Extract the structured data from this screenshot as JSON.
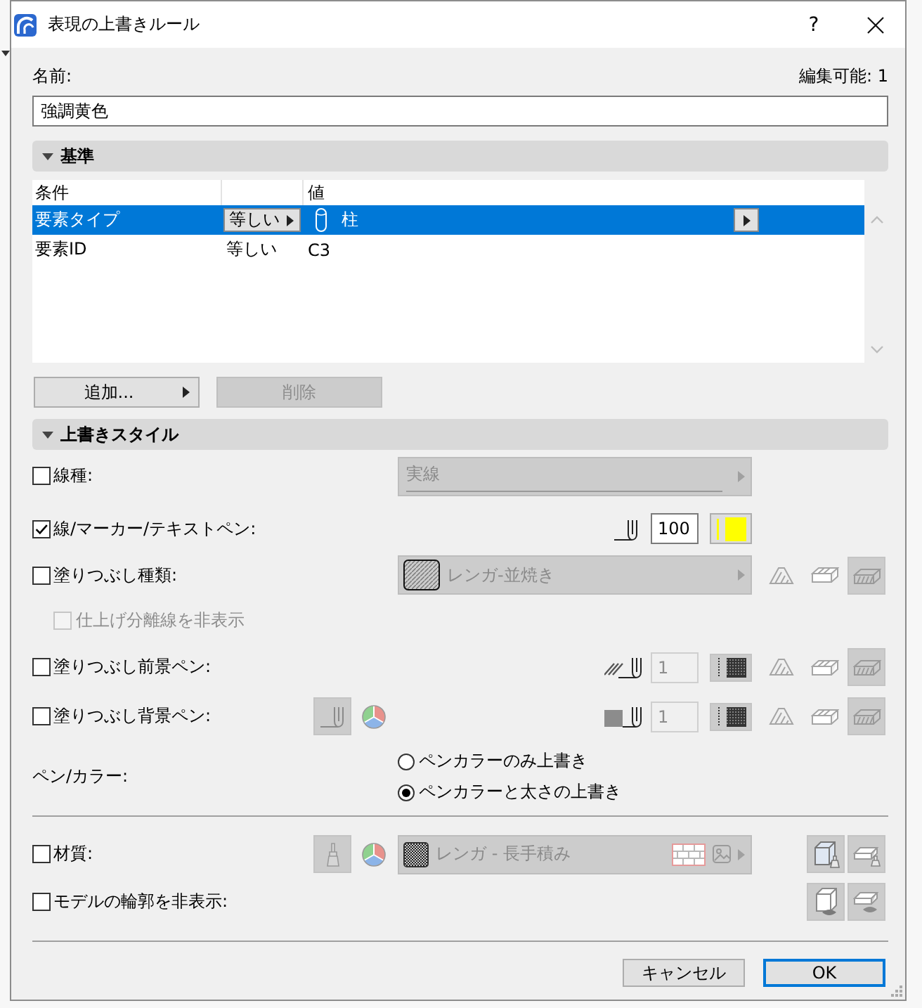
{
  "window": {
    "title": "表現の上書きルール",
    "help": "?"
  },
  "name_field": {
    "label": "名前:",
    "value": "強調黄色"
  },
  "edit_count": "編集可能: 1",
  "criteria": {
    "title": "基準",
    "expanded": true,
    "header": {
      "condition": "条件",
      "value": "値"
    },
    "rows": [
      {
        "condition": "要素タイプ",
        "operator": "等しい",
        "value": "柱",
        "selected": true
      },
      {
        "condition": "要素ID",
        "operator": "等しい",
        "value": "C3",
        "selected": false
      }
    ],
    "buttons": [
      {
        "kind": "menu",
        "label": "追加...",
        "disabled": false
      },
      {
        "kind": "action",
        "label": "削除",
        "disabled": true
      }
    ]
  },
  "override_style": {
    "title": "上書きスタイル",
    "expanded": true,
    "rows": [
      {
        "kind": "dropdown",
        "label": "線種:",
        "checked": false,
        "value": "実線",
        "disabled": true
      },
      {
        "kind": "pen",
        "label": "線/マーカー/テキストペン:",
        "checked": true,
        "pen": "100",
        "color": "#ffff00",
        "disabled": false
      },
      {
        "kind": "fill",
        "label": "塗りつぶし種類:",
        "checked": false,
        "value": "レンガ-並焼き",
        "disabled": true,
        "option": {
          "label": "仕上げ分離線を非表示",
          "checked": false,
          "disabled": true
        }
      },
      {
        "kind": "fg_pen",
        "label": "塗りつぶし前景ペン:",
        "checked": false,
        "pen": "1",
        "disabled": true
      },
      {
        "kind": "bg_pen",
        "label": "塗りつぶし背景ペン:",
        "checked": false,
        "pen": "1",
        "disabled": true
      },
      {
        "kind": "radio",
        "label": "ペン/カラー:",
        "options": [
          {
            "label": "ペンカラーのみ上書き",
            "selected": false
          },
          {
            "label": "ペンカラーと太さの上書き",
            "selected": true
          }
        ]
      },
      {
        "kind": "material",
        "label": "材質:",
        "checked": false,
        "value": "レンガ - 長手積み",
        "disabled": true
      },
      {
        "kind": "outline",
        "label": "モデルの輪郭を非表示:",
        "checked": false,
        "disabled": true
      }
    ]
  },
  "buttons": [
    {
      "label": "キャンセル",
      "default": false
    },
    {
      "label": "OK",
      "default": true
    }
  ]
}
